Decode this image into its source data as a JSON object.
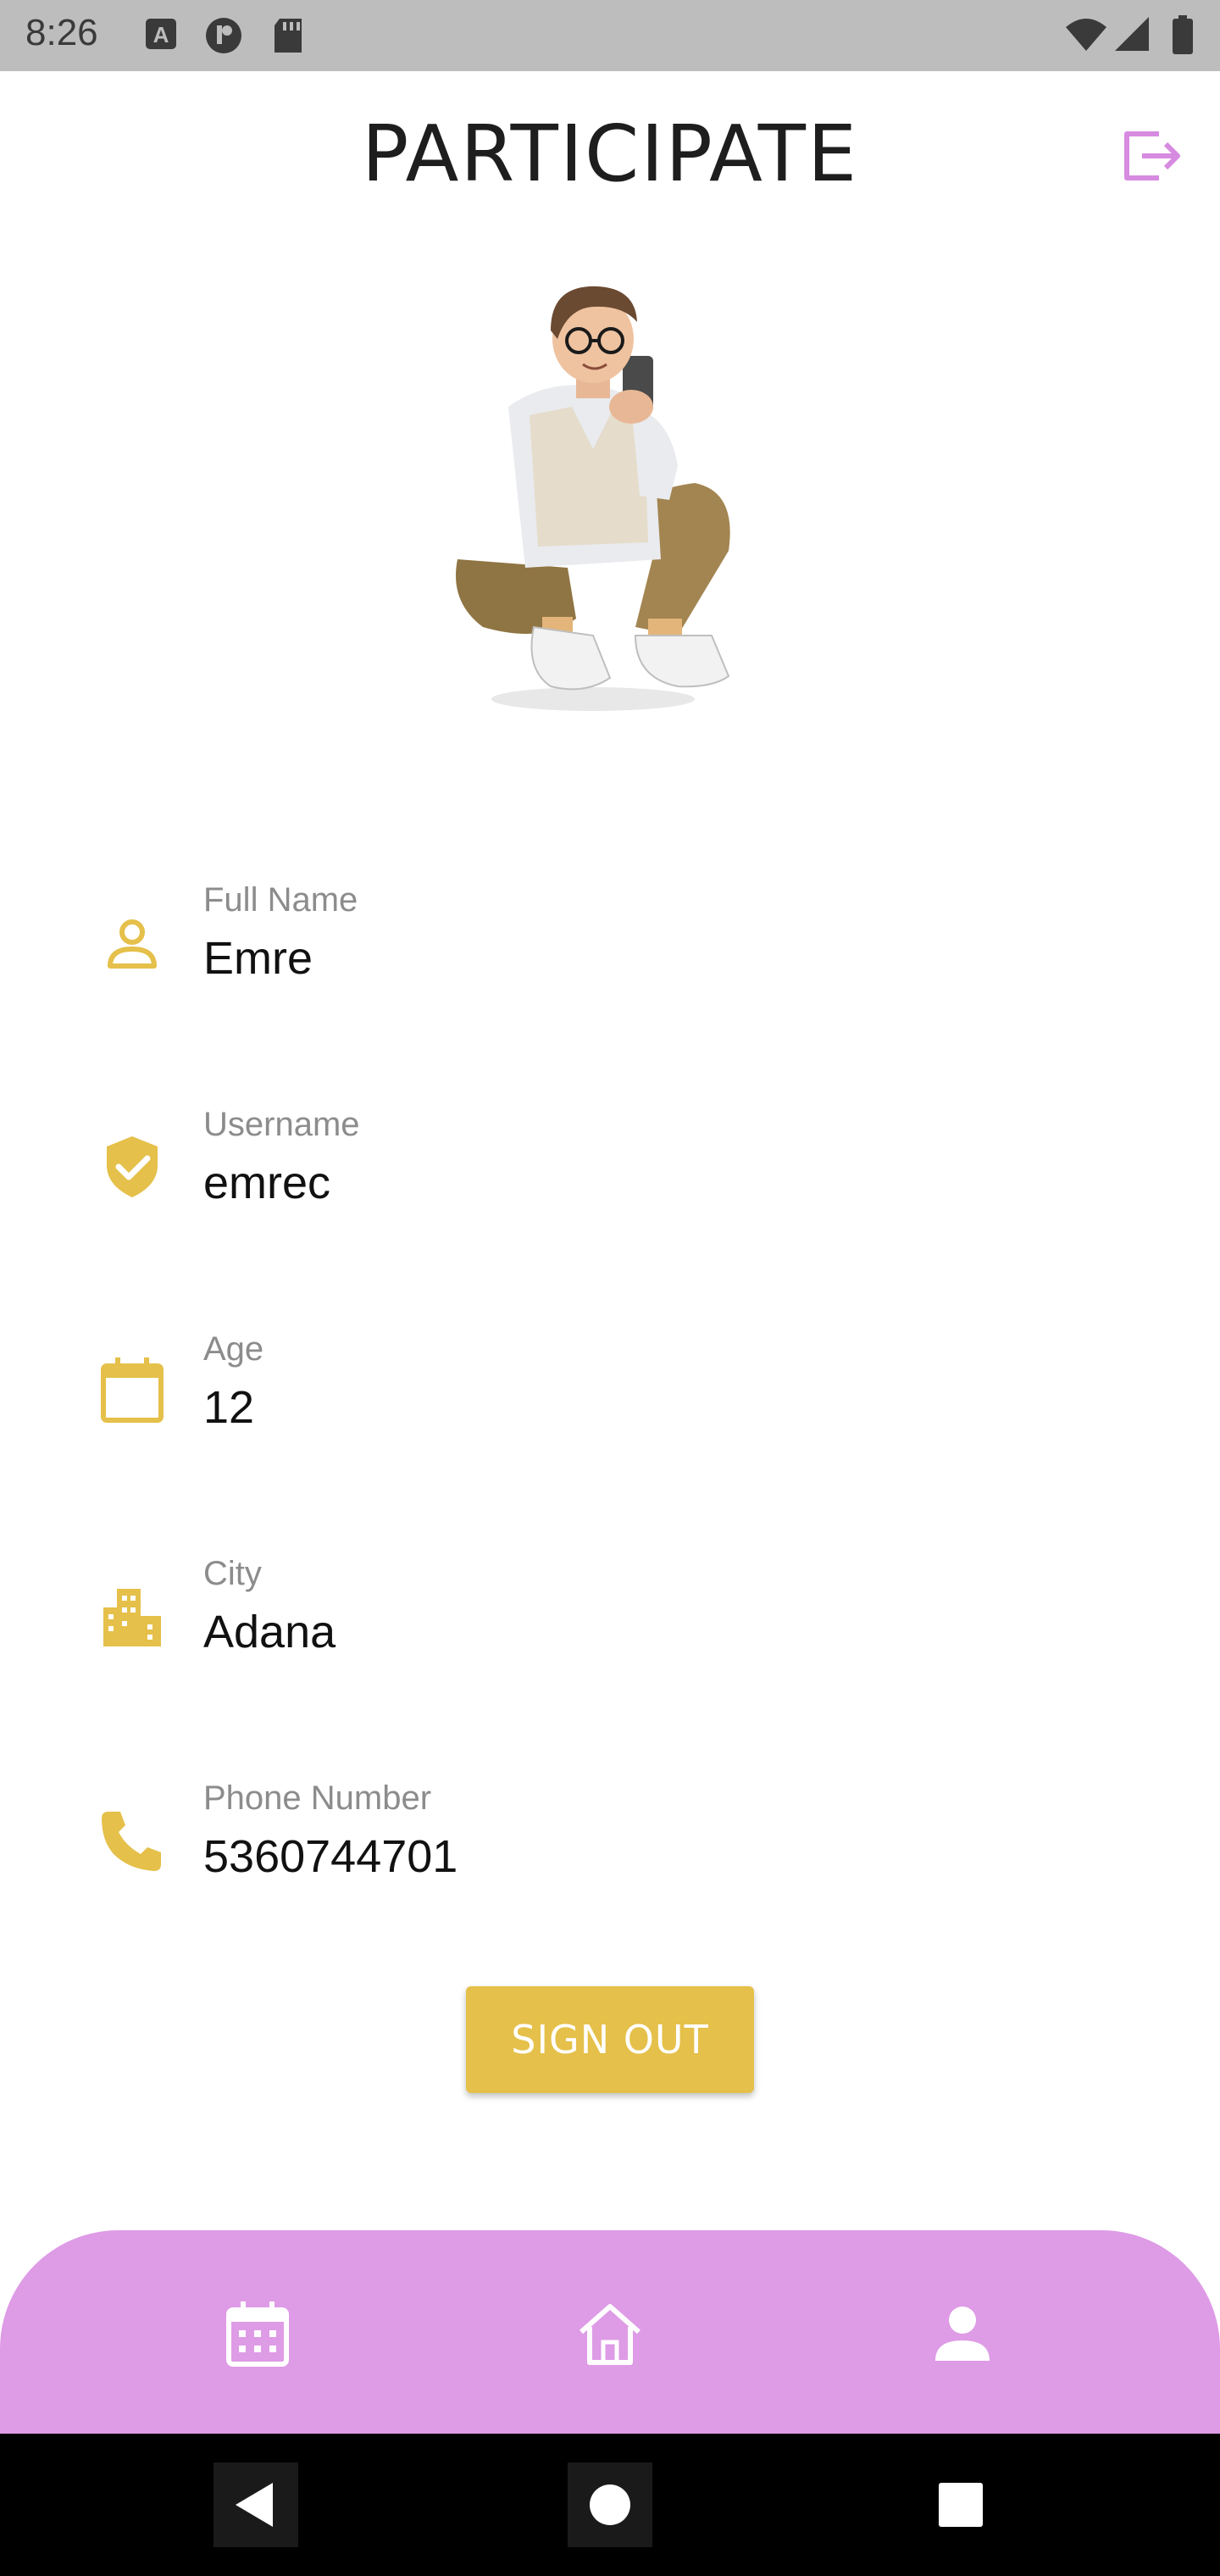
{
  "status_bar": {
    "time": "8:26",
    "notification_icons": [
      "accessibility-a-icon",
      "media-icon",
      "sd-card-icon"
    ],
    "status_icons": [
      "wifi-icon",
      "cell-signal-icon",
      "battery-icon"
    ]
  },
  "header": {
    "title": "PARTICIPATE",
    "logout_icon": "logout-icon"
  },
  "avatar": {
    "icon": "avatar-illustration"
  },
  "profile": {
    "fields": [
      {
        "label": "Full Name",
        "value": "Emre",
        "icon": "person-outline-icon"
      },
      {
        "label": "Username",
        "value": "emrec",
        "icon": "shield-check-icon"
      },
      {
        "label": "Age",
        "value": "12",
        "icon": "calendar-icon"
      },
      {
        "label": "City",
        "value": "Adana",
        "icon": "city-icon"
      },
      {
        "label": "Phone Number",
        "value": "5360744701",
        "icon": "phone-icon"
      }
    ]
  },
  "actions": {
    "sign_out_label": "SIGN OUT"
  },
  "bottom_nav": {
    "items": [
      "calendar-icon",
      "home-icon",
      "profile-icon"
    ]
  },
  "android_nav": {
    "items": [
      "back-icon",
      "home-circle-icon",
      "recents-icon"
    ]
  },
  "colors": {
    "accent_yellow": "#E5C04A",
    "nav_purple": "#DE9BE6",
    "logout_purple": "#D68BE0",
    "status_bar_gray": "#BDBDBD"
  }
}
